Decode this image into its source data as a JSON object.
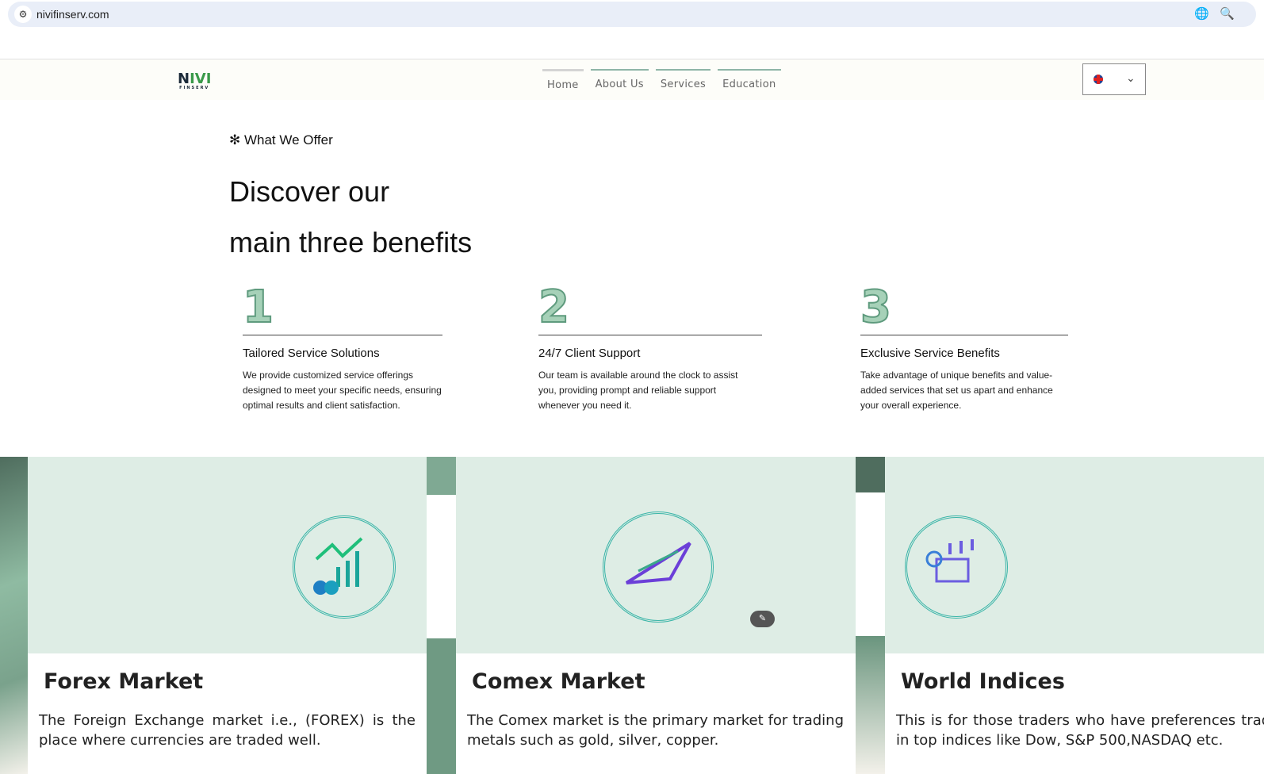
{
  "browser": {
    "url": "nivifinserv.com"
  },
  "nav": {
    "logo": "NIVI FINSERV",
    "items": [
      "Home",
      "About Us",
      "Services",
      "Education"
    ]
  },
  "hero": {
    "kicker": "What We Offer",
    "title_line1": "Discover our",
    "title_line2": "main three benefits"
  },
  "benefits": [
    {
      "num": "1",
      "title": "Tailored Service Solutions",
      "text": "We provide customized service offerings designed to meet your specific needs, ensuring optimal results and client satisfaction."
    },
    {
      "num": "2",
      "title": "24/7 Client Support",
      "text": "Our team is available around the clock to assist you, providing prompt and reliable support whenever you need it."
    },
    {
      "num": "3",
      "title": "Exclusive Service Benefits",
      "text": "Take advantage of unique benefits and value-added services that set us apart and enhance your overall experience."
    }
  ],
  "cards": [
    {
      "title": "Forex Market",
      "text": "The Foreign Exchange market i.e., (FOREX) is the place where currencies are traded well."
    },
    {
      "title": "Comex Market",
      "text": "The Comex market is the primary market for trading metals such as gold, silver, copper."
    },
    {
      "title": "World Indices",
      "text": "This is for those traders who have preferences trading in top indices like Dow, S&P 500,NASDAQ etc."
    }
  ]
}
